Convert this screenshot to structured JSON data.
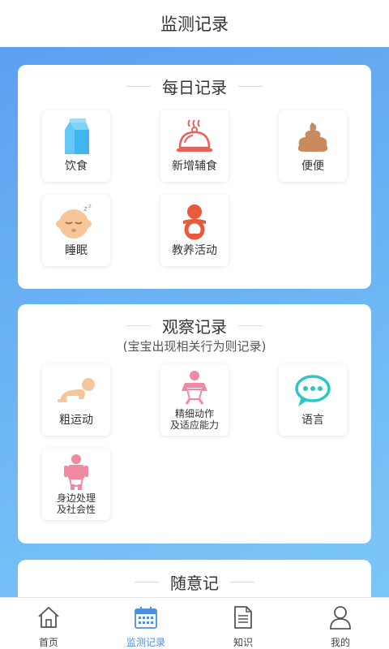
{
  "header": {
    "title": "监测记录"
  },
  "daily": {
    "title": "每日记录",
    "items": [
      {
        "label": "饮食",
        "icon": "milk-carton-icon"
      },
      {
        "label": "新增辅食",
        "icon": "food-cloche-icon"
      },
      {
        "label": "便便",
        "icon": "poop-icon"
      },
      {
        "label": "睡眠",
        "icon": "sleeping-baby-icon"
      },
      {
        "label": "教养活动",
        "icon": "baby-activity-icon"
      }
    ]
  },
  "observe": {
    "title": "观察记录",
    "subtitle": "(宝宝出现相关行为则记录)",
    "items": [
      {
        "label": "粗运动",
        "icon": "crawling-baby-icon"
      },
      {
        "label1": "精细动作",
        "label2": "及适应能力",
        "icon": "baby-diaper-icon"
      },
      {
        "label": "语言",
        "icon": "speech-bubble-icon"
      },
      {
        "label1": "身边处理",
        "label2": "及社会性",
        "icon": "child-icon"
      }
    ]
  },
  "casual": {
    "title": "随意记"
  },
  "tabs": [
    {
      "label": "首页",
      "icon": "home-icon"
    },
    {
      "label": "监测记录",
      "icon": "calendar-icon"
    },
    {
      "label": "知识",
      "icon": "document-icon"
    },
    {
      "label": "我的",
      "icon": "user-icon"
    }
  ],
  "colors": {
    "accent": "#4a8fe0",
    "milk": "#3fb6f0",
    "food": "#e8625a",
    "poop": "#c98a5e",
    "skin": "#f7c59a",
    "activity": "#e85a3a",
    "pink": "#f08aa0",
    "teal": "#2cc6c6"
  }
}
